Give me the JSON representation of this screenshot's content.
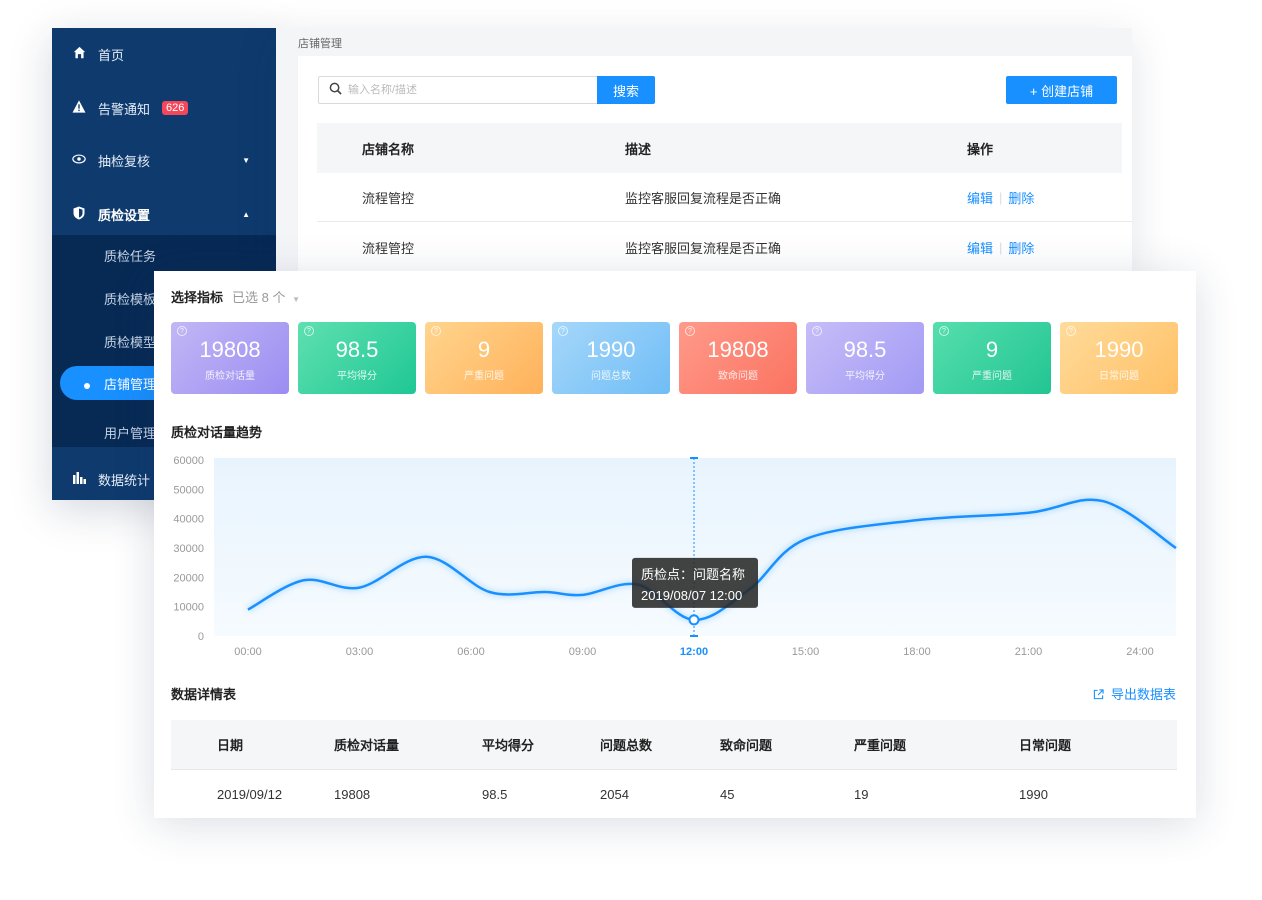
{
  "sidebar": {
    "items": [
      {
        "label": "首页",
        "icon": "home-icon"
      },
      {
        "label": "告警通知",
        "icon": "warning-icon",
        "badge": "626"
      },
      {
        "label": "抽检复核",
        "icon": "eye-icon"
      },
      {
        "label": "质检设置",
        "icon": "shield-icon"
      }
    ],
    "submenu": [
      "质检任务",
      "质检模板",
      "质检模型",
      "店铺管理",
      "用户管理"
    ],
    "bottom": {
      "label": "数据统计",
      "icon": "bar-chart-icon"
    }
  },
  "store_page": {
    "breadcrumb": "店铺管理",
    "search_placeholder": "输入名称/描述",
    "search_label": "搜索",
    "create_label": "+ 创建店铺",
    "columns": [
      "店铺名称",
      "描述",
      "操作"
    ],
    "rows": [
      {
        "name": "流程管控",
        "desc": "监控客服回复流程是否正确",
        "edit": "编辑",
        "delete": "删除"
      },
      {
        "name": "流程管控",
        "desc": "监控客服回复流程是否正确",
        "edit": "编辑",
        "delete": "删除"
      }
    ]
  },
  "dashboard": {
    "metric_title": "选择指标",
    "metric_selected": "已选 8 个",
    "metrics": [
      {
        "value": "19808",
        "label": "质检对话量",
        "from": "#c2b7f5",
        "to": "#9b8df2"
      },
      {
        "value": "98.5",
        "label": "平均得分",
        "from": "#5fe0b0",
        "to": "#1fc794"
      },
      {
        "value": "9",
        "label": "严重问题",
        "from": "#ffd58e",
        "to": "#ffb15a"
      },
      {
        "value": "1990",
        "label": "问题总数",
        "from": "#a5d7fa",
        "to": "#70bdf6"
      },
      {
        "value": "19808",
        "label": "致命问题",
        "from": "#ff9a8a",
        "to": "#fb7361"
      },
      {
        "value": "98.5",
        "label": "平均得分",
        "from": "#c6bdf8",
        "to": "#a29af4"
      },
      {
        "value": "9",
        "label": "严重问题",
        "from": "#56deae",
        "to": "#22c592"
      },
      {
        "value": "1990",
        "label": "日常问题",
        "from": "#ffdb9a",
        "to": "#ffc066"
      }
    ],
    "trend_title": "质检对话量趋势",
    "tooltip": {
      "line1": "质检点：问题名称",
      "line2": "2019/08/07 12:00"
    },
    "detail_title": "数据详情表",
    "export_label": "导出数据表",
    "detail_columns": [
      "日期",
      "质检对话量",
      "平均得分",
      "问题总数",
      "致命问题",
      "严重问题",
      "日常问题"
    ],
    "detail_rows": [
      [
        "2019/09/12",
        "19808",
        "98.5",
        "2054",
        "45",
        "19",
        "1990"
      ]
    ],
    "accent": "#1890ff"
  },
  "chart_data": {
    "type": "line",
    "title": "质检对话量趋势",
    "yticks": [
      "60000",
      "50000",
      "40000",
      "30000",
      "20000",
      "10000",
      "0"
    ],
    "xticks": [
      "00:00",
      "03:00",
      "06:00",
      "09:00",
      "12:00",
      "15:00",
      "18:00",
      "21:00",
      "24:00"
    ],
    "highlight_x": "12:00",
    "ylim": [
      0,
      60000
    ],
    "x_hours": [
      0,
      1.5,
      3,
      4.8,
      6.5,
      8,
      9,
      10.5,
      12,
      13.5,
      15,
      18,
      21,
      23,
      25
    ],
    "values": [
      9000,
      19000,
      16500,
      27000,
      15000,
      15000,
      14000,
      17500,
      5500,
      16000,
      33000,
      39500,
      42000,
      46000,
      30000
    ],
    "highlight_point": {
      "x_hours": 12,
      "value": 5500
    },
    "grid": false
  }
}
